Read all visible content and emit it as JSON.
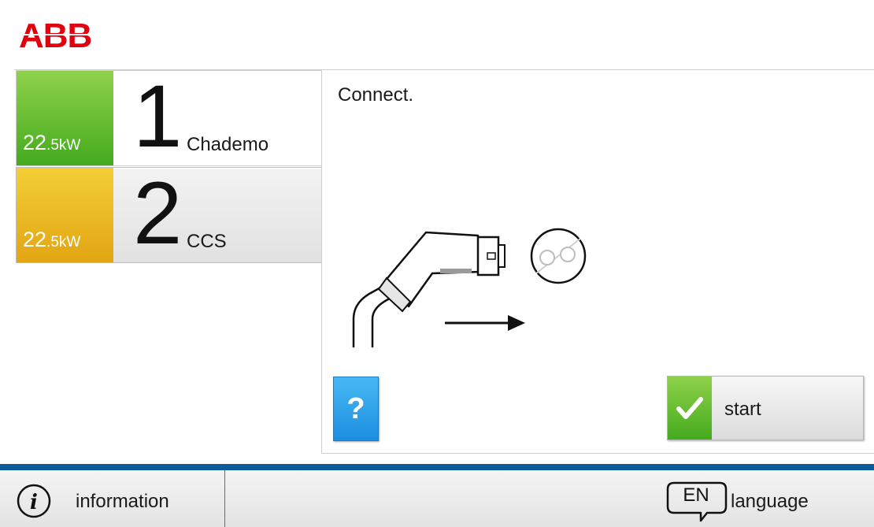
{
  "brand": {
    "logo_text": "ABB",
    "logo_color": "#e2000f"
  },
  "connectors": [
    {
      "number": "1",
      "power_main": "22",
      "power_small": ".5kW",
      "name": "Chademo",
      "status_color": "#44aa1e"
    },
    {
      "number": "2",
      "power_main": "22",
      "power_small": ".5kW",
      "name": "CCS",
      "status_color": "#e2a514"
    }
  ],
  "panel": {
    "title": "Connect.",
    "illustration_icon": "plug-connect-icon"
  },
  "buttons": {
    "help_label": "?",
    "start_label": "start",
    "start_icon": "checkmark-icon"
  },
  "footer": {
    "info_label": "information",
    "info_icon": "info-icon",
    "language_code": "EN",
    "language_label": "language",
    "language_icon": "speech-bubble-icon"
  },
  "colors": {
    "footer_bar": "#0b5a99",
    "help_blue": "#1d8ee0"
  }
}
